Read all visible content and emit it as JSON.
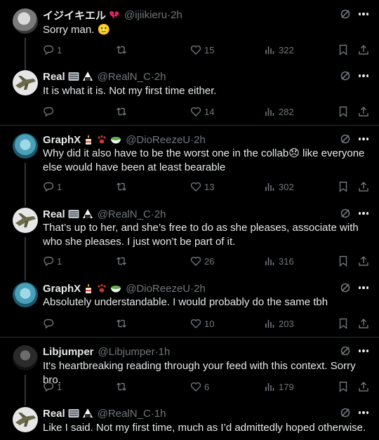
{
  "tweets": [
    {
      "name": "イジイキエル",
      "badges": [
        "broken-heart-emoji"
      ],
      "handle": "@ijiikieru",
      "time": "2h",
      "text": "Sorry man. 🙂",
      "reply_count": "1",
      "retweet_count": "",
      "like_count": "15",
      "view_count": "322"
    },
    {
      "name": "Real",
      "badges": [
        "keyboard-emoji",
        "onigiri-emoji"
      ],
      "handle": "@RealN_C",
      "time": "2h",
      "text": "It is what it is. Not my first time either.",
      "reply_count": "",
      "retweet_count": "",
      "like_count": "14",
      "view_count": "282"
    },
    {
      "name": "GraphX",
      "badges": [
        "candle-emoji",
        "paw-emoji",
        "bowl-emoji"
      ],
      "handle": "@DioReezeU",
      "time": "2h",
      "text": "Why did it also have to be the worst one in the collab😞 like everyone else would have been at least bearable",
      "reply_count": "1",
      "retweet_count": "",
      "like_count": "13",
      "view_count": "302"
    },
    {
      "name": "Real",
      "badges": [
        "keyboard-emoji",
        "onigiri-emoji"
      ],
      "handle": "@RealN_C",
      "time": "2h",
      "text": "That’s up to her, and she’s free to do as she pleases, associate with who she pleases. I just won’t be part of it.",
      "reply_count": "1",
      "retweet_count": "",
      "like_count": "26",
      "view_count": "316"
    },
    {
      "name": "GraphX",
      "badges": [
        "candle-emoji",
        "paw-emoji",
        "bowl-emoji"
      ],
      "handle": "@DioReezeU",
      "time": "2h",
      "text": "Absolutely understandable. I would probably do the same tbh",
      "reply_count": "",
      "retweet_count": "",
      "like_count": "10",
      "view_count": "203"
    },
    {
      "name": "Libjumper",
      "badges": [],
      "handle": "@Libjumper",
      "time": "1h",
      "text": "It's heartbreaking reading through your feed with this context. Sorry bro.",
      "reply_count": "1",
      "retweet_count": "",
      "like_count": "6",
      "view_count": "179"
    },
    {
      "name": "Real",
      "badges": [
        "keyboard-emoji",
        "onigiri-emoji"
      ],
      "handle": "@RealN_C",
      "time": "1h",
      "text": "Like I said. Not my first time, much as I’d admittedly hoped otherwise.",
      "reply_count": "",
      "retweet_count": "",
      "like_count": "",
      "view_count": ""
    }
  ],
  "separator": " · ",
  "colors": {
    "background": "#000000",
    "text": "#e7e9ea",
    "muted": "#71767b",
    "divider": "#2f3336"
  }
}
